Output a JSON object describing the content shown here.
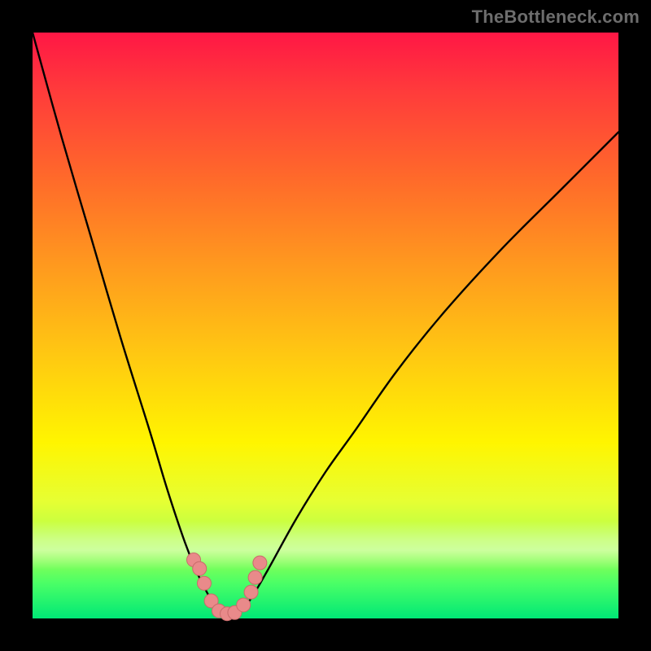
{
  "watermark": {
    "text": "TheBottleneck.com"
  },
  "colors": {
    "background": "#000000",
    "gradient_top": "#ff1745",
    "gradient_bottom": "#00e876",
    "curve_stroke": "#000000",
    "marker_fill": "#e98a8a",
    "marker_stroke": "#c96b6b"
  },
  "chart_data": {
    "type": "line",
    "title": "",
    "xlabel": "",
    "ylabel": "",
    "xlim": [
      0,
      100
    ],
    "ylim": [
      0,
      100
    ],
    "grid": false,
    "legend": false,
    "series": [
      {
        "name": "curve",
        "x": [
          0,
          5,
          10,
          15,
          20,
          23,
          26,
          28,
          30,
          31,
          32,
          33,
          34,
          35,
          37,
          40,
          45,
          50,
          55,
          62,
          70,
          80,
          90,
          100
        ],
        "y": [
          100,
          82,
          65,
          48,
          32,
          22,
          13,
          8,
          4,
          2,
          1,
          0.5,
          0.5,
          1,
          3,
          8,
          17,
          25,
          32,
          42,
          52,
          63,
          73,
          83
        ]
      }
    ],
    "markers": [
      {
        "x": 27.5,
        "y": 10
      },
      {
        "x": 28.5,
        "y": 8.5
      },
      {
        "x": 29.3,
        "y": 6
      },
      {
        "x": 30.5,
        "y": 3
      },
      {
        "x": 31.8,
        "y": 1.3
      },
      {
        "x": 33.2,
        "y": 0.8
      },
      {
        "x": 34.5,
        "y": 1.0
      },
      {
        "x": 36.0,
        "y": 2.3
      },
      {
        "x": 37.3,
        "y": 4.5
      },
      {
        "x": 38.0,
        "y": 7
      },
      {
        "x": 38.8,
        "y": 9.5
      }
    ],
    "note": "y-axis represents bottleneck percentage (0 at bottom = optimal/green, 100 at top = severe/red). x-axis is an unlabeled configuration parameter. Curve dips to a minimum near x≈33 then rises more gently to the right."
  }
}
